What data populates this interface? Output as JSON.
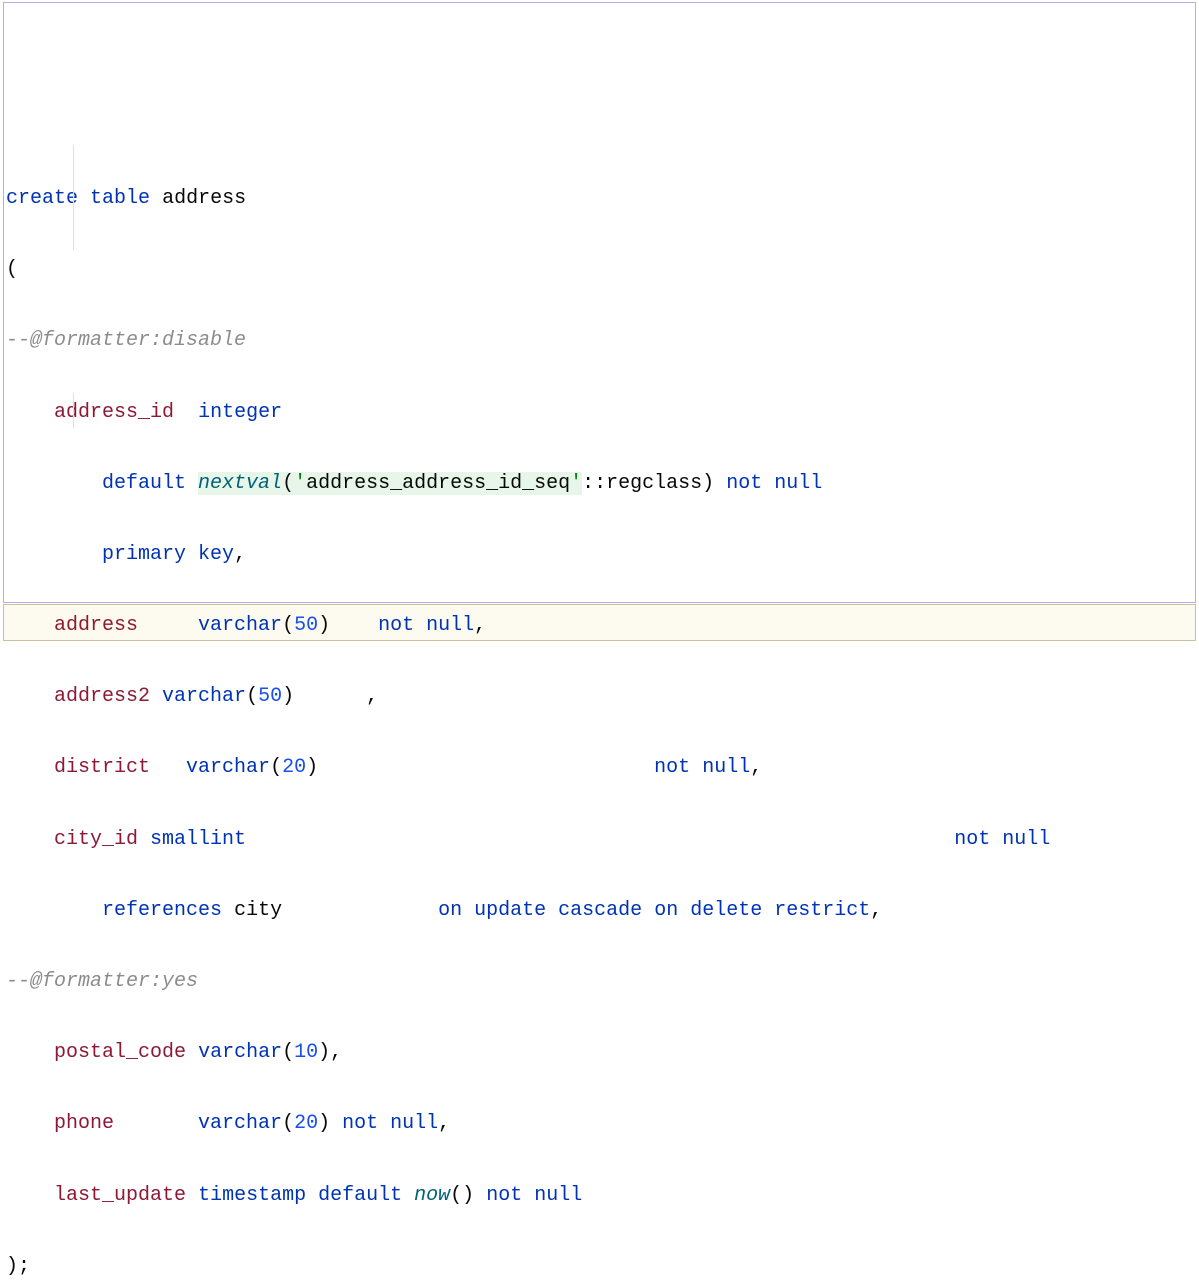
{
  "code": {
    "line1": {
      "create": "create",
      "table": "table",
      "name": "address"
    },
    "line2": "(",
    "line3": "--@formatter:disable",
    "line4": {
      "col": "address_id",
      "type": "integer"
    },
    "line5": {
      "default": "default",
      "func": "nextval",
      "lparen": "(",
      "str_q1": "'",
      "str_val": "address_address_id_seq",
      "str_q2": "'",
      "cast": "::regclass)",
      "not": "not",
      "null": "null"
    },
    "line6": {
      "primary": "primary",
      "key": "key",
      "comma": ","
    },
    "line7": {
      "col": "address",
      "type": "varchar",
      "lparen": "(",
      "size": "50",
      "rparen": ")",
      "not": "not",
      "null": "null",
      "comma": ","
    },
    "line8": {
      "col": "address2",
      "type": "varchar",
      "lparen": "(",
      "size": "50",
      "rparen": ")",
      "comma": ","
    },
    "line9": {
      "col": "district",
      "type": "varchar",
      "lparen": "(",
      "size": "20",
      "rparen": ")",
      "not": "not",
      "null": "null",
      "comma": ","
    },
    "line10": {
      "col": "city_id",
      "type": "smallint",
      "not": "not",
      "null": "null"
    },
    "line11": {
      "references": "references",
      "table": "city",
      "on1": "on",
      "update": "update",
      "cascade": "cascade",
      "on2": "on",
      "delete": "delete",
      "restrict": "restrict",
      "comma": ","
    },
    "line12": "--@formatter:yes",
    "line13": {
      "col": "postal_code",
      "type": "varchar",
      "lparen": "(",
      "size": "10",
      "rparen": "),",
      "comma": ""
    },
    "line14": {
      "col": "phone",
      "type": "varchar",
      "lparen": "(",
      "size": "20",
      "rparen": ")",
      "not": "not",
      "null": "null",
      "comma": ","
    },
    "line15": {
      "col": "last_update",
      "type": "timestamp",
      "default": "default",
      "func": "now",
      "parens": "()",
      "not": "not",
      "null": "null"
    },
    "line16": ");"
  }
}
